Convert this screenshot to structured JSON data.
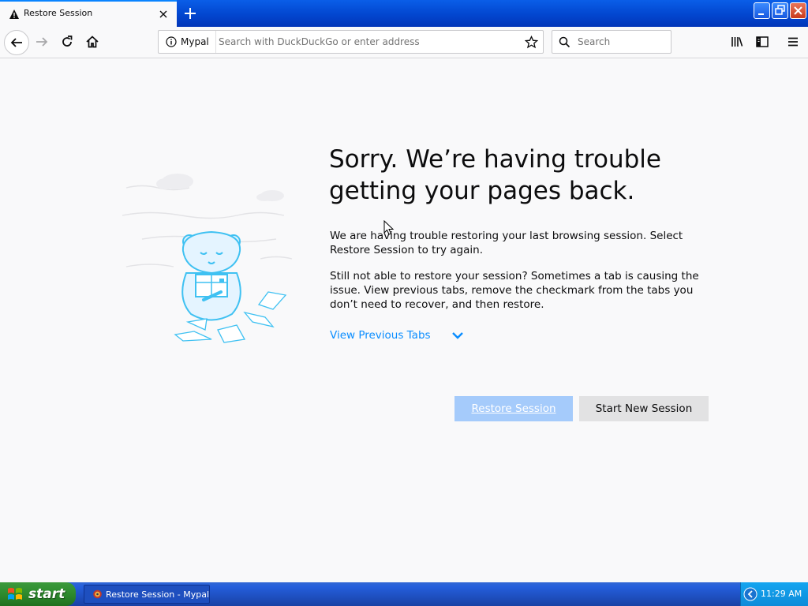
{
  "browser": {
    "tab": {
      "title": "Restore Session",
      "icon": "warning-icon"
    },
    "identity_label": "Mypal",
    "url_placeholder": "Search with DuckDuckGo or enter address",
    "search_placeholder": "Search"
  },
  "page": {
    "headline": "Sorry. We’re having trouble getting your pages back.",
    "paragraph1": "We are having trouble restoring your last browsing session. Select Restore Session to try again.",
    "paragraph2": "Still not able to restore your session? Sometimes a tab is causing the issue. View previous tabs, remove the checkmark from the tabs you don’t need to recover, and then restore.",
    "view_previous_tabs": "View Previous Tabs",
    "restore_button": "Restore Session",
    "new_session_button": "Start New Session"
  },
  "taskbar": {
    "start_label": "start",
    "task_label": "Restore Session - Mypal",
    "clock": "11:29 AM"
  },
  "colors": {
    "accent": "#0a84ff",
    "link": "#0a8dff",
    "primary_button_disabled": "#a5cbfb",
    "secondary_button": "#e2e2e3",
    "titlebar_blue": "#0246cf",
    "taskbar_blue": "#245edb",
    "start_green": "#2d8a2d"
  }
}
